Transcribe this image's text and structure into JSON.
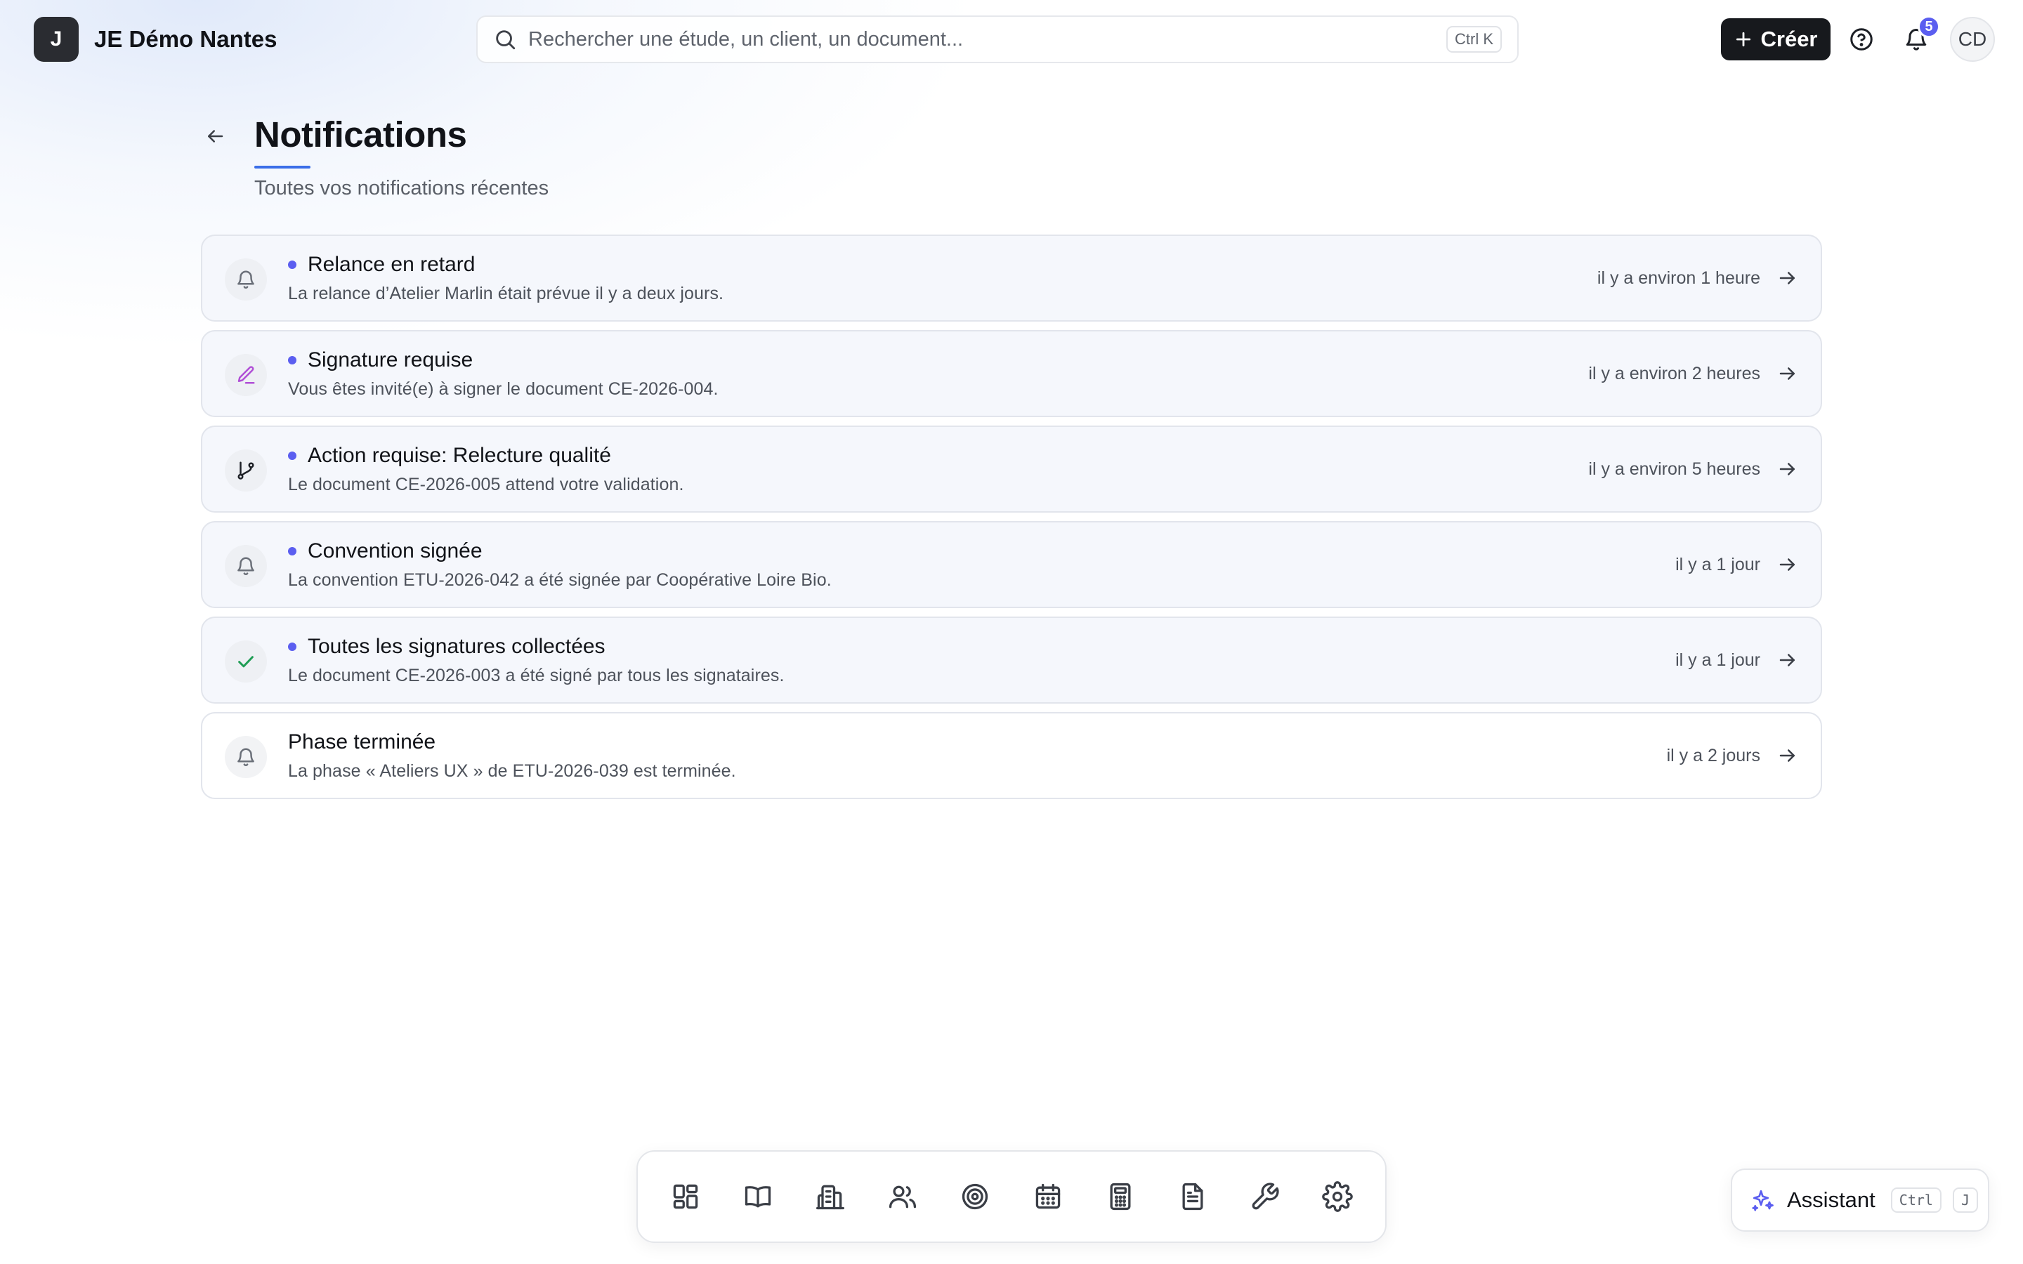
{
  "app": {
    "logo_letter": "J",
    "name": "JE Démo Nantes"
  },
  "search": {
    "placeholder": "Rechercher une étude, un client, un document...",
    "shortcut": "Ctrl K"
  },
  "header_actions": {
    "create_label": "Créer",
    "notification_count": "5",
    "avatar_initials": "CD"
  },
  "page": {
    "title": "Notifications",
    "subtitle": "Toutes vos notifications récentes"
  },
  "notifications": [
    {
      "icon": "bell-icon",
      "icon_color": "#6b7079",
      "unread": true,
      "title": "Relance en retard",
      "description": "La relance d’Atelier Marlin était prévue il y a deux jours.",
      "time": "il y a environ 1 heure"
    },
    {
      "icon": "pen-icon",
      "icon_color": "#b04fd6",
      "unread": true,
      "title": "Signature requise",
      "description": "Vous êtes invité(e) à signer le document CE-2026-004.",
      "time": "il y a environ 2 heures"
    },
    {
      "icon": "git-branch-icon",
      "icon_color": "#1d2026",
      "unread": true,
      "title": "Action requise: Relecture qualité",
      "description": "Le document CE-2026-005 attend votre validation.",
      "time": "il y a environ 5 heures"
    },
    {
      "icon": "bell-icon",
      "icon_color": "#6b7079",
      "unread": true,
      "title": "Convention signée",
      "description": "La convention ETU-2026-042 a été signée par Coopérative Loire Bio.",
      "time": "il y a 1 jour"
    },
    {
      "icon": "check-icon",
      "icon_color": "#1f9d55",
      "unread": true,
      "title": "Toutes les signatures collectées",
      "description": "Le document CE-2026-003 a été signé par tous les signataires.",
      "time": "il y a 1 jour"
    },
    {
      "icon": "bell-icon",
      "icon_color": "#6b7079",
      "unread": false,
      "title": "Phase terminée",
      "description": "La phase « Ateliers UX » de ETU-2026-039 est terminée.",
      "time": "il y a 2 jours"
    }
  ],
  "dock": {
    "items": [
      {
        "icon": "dashboard-icon"
      },
      {
        "icon": "book-icon"
      },
      {
        "icon": "building-icon"
      },
      {
        "icon": "users-icon"
      },
      {
        "icon": "target-icon"
      },
      {
        "icon": "calendar-icon"
      },
      {
        "icon": "calculator-icon"
      },
      {
        "icon": "document-icon"
      },
      {
        "icon": "wrench-icon"
      },
      {
        "icon": "settings-icon"
      }
    ]
  },
  "assistant": {
    "label": "Assistant",
    "shortcut_modifier": "Ctrl",
    "shortcut_key": "J"
  },
  "colors": {
    "accent": "#5b5ef0",
    "title_underline": "#3b6ee8",
    "primary_button": "#17191d"
  }
}
